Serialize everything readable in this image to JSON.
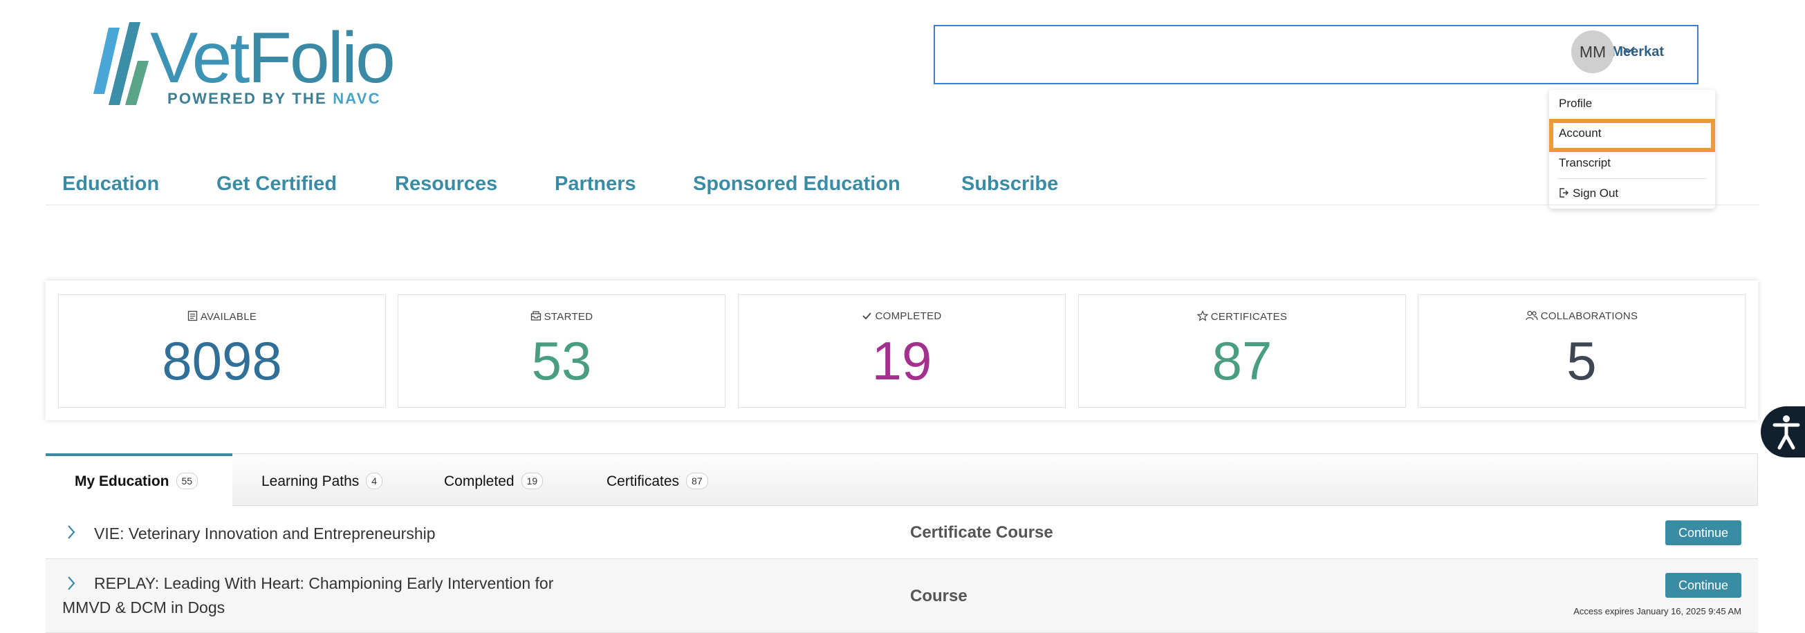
{
  "logo": {
    "brand_vet": "Vet",
    "brand_folio": "Folio",
    "tagline_prefix": "POWERED BY THE",
    "tagline_navc": "NAVC",
    "colors": {
      "vet": "#3d93b5",
      "stripe_blue": "#4aa6d6",
      "stripe_green": "#5aa48a"
    }
  },
  "header": {
    "user_name": "Max Meerkat",
    "avatar_initials": "MM",
    "menu": {
      "profile": "Profile",
      "account": "Account",
      "transcript": "Transcript",
      "sign_out": "Sign Out"
    }
  },
  "nav": {
    "items": [
      "Education",
      "Get Certified",
      "Resources",
      "Partners",
      "Sponsored Education",
      "Subscribe"
    ]
  },
  "stats": [
    {
      "label": "AVAILABLE",
      "value": "8098",
      "icon": "document-icon",
      "color": "#2f6f98"
    },
    {
      "label": "STARTED",
      "value": "53",
      "icon": "inbox-icon",
      "color": "#4a9e80"
    },
    {
      "label": "COMPLETED",
      "value": "19",
      "icon": "check-icon",
      "color": "#a3308c"
    },
    {
      "label": "CERTIFICATES",
      "value": "87",
      "icon": "star-icon",
      "color": "#4a9e80"
    },
    {
      "label": "COLLABORATIONS",
      "value": "5",
      "icon": "users-icon",
      "color": "#3d4652"
    }
  ],
  "tabs": [
    {
      "label": "My Education",
      "count": "55",
      "active": true
    },
    {
      "label": "Learning Paths",
      "count": "4",
      "active": false
    },
    {
      "label": "Completed",
      "count": "19",
      "active": false
    },
    {
      "label": "Certificates",
      "count": "87",
      "active": false
    }
  ],
  "rows": [
    {
      "title": "VIE: Veterinary Innovation and Entrepreneurship",
      "type": "Certificate Course",
      "action": "Continue"
    },
    {
      "title_line1": "REPLAY: Leading With Heart: Championing Early Intervention for",
      "title_line2": "MMVD & DCM in Dogs",
      "type": "Course",
      "action": "Continue",
      "expires": "Access expires January 16, 2025 9:45 AM"
    }
  ],
  "accent": "#3a8ca4",
  "highlight": "#ee9a3c"
}
